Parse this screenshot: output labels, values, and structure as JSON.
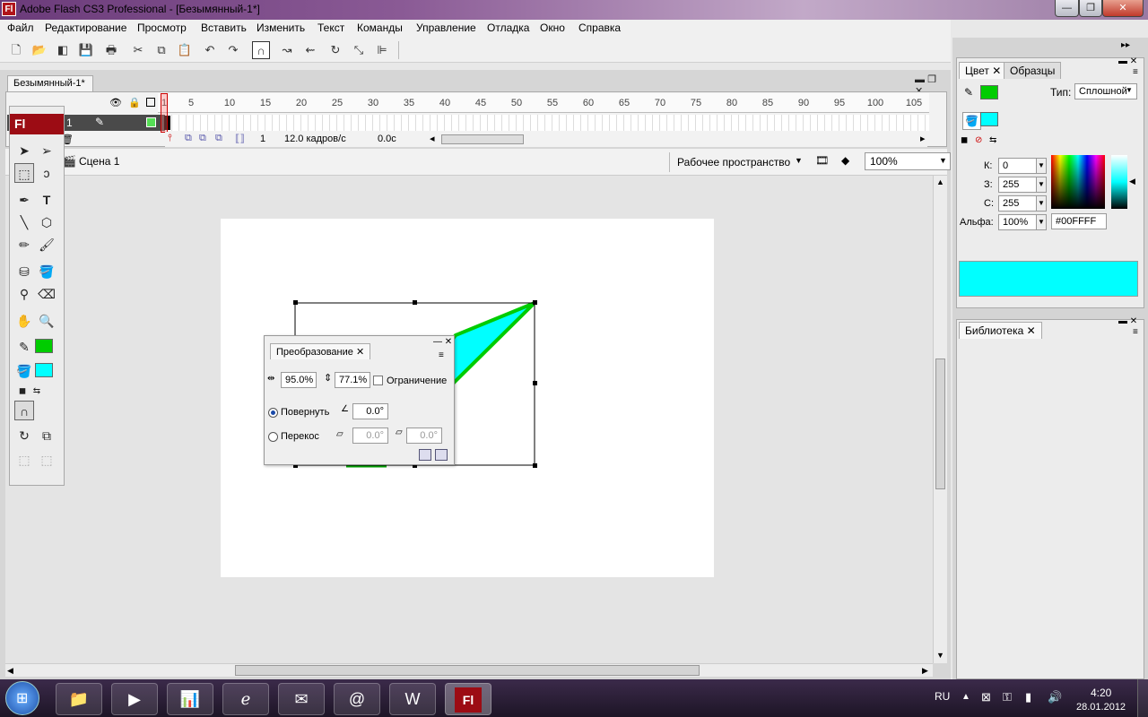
{
  "window": {
    "title": "Adobe Flash CS3 Professional - [Безымянный-1*]",
    "app_icon": "Fl"
  },
  "menu": [
    "Файл",
    "Редактирование",
    "Просмотр",
    "Вставить",
    "Изменить",
    "Текст",
    "Команды",
    "Управление",
    "Отладка",
    "Окно",
    "Справка"
  ],
  "document": {
    "tab": "Безымянный-1*"
  },
  "timeline": {
    "ruler": [
      "1",
      "5",
      "10",
      "15",
      "20",
      "25",
      "30",
      "35",
      "40",
      "45",
      "50",
      "55",
      "60",
      "65",
      "70",
      "75",
      "80",
      "85",
      "90",
      "95",
      "100",
      "105"
    ],
    "layer_name": "1",
    "current_frame": "1",
    "frame_rate": "12.0 кадров/с",
    "elapsed": "0.0с"
  },
  "scene": {
    "name": "Сцена 1",
    "workspace": "Рабочее пространство",
    "zoom": "100%"
  },
  "tools": {
    "header": "Fl"
  },
  "color_panel": {
    "tabs": [
      "Цвет",
      "Образцы"
    ],
    "type_label": "Тип:",
    "type_value": "Сплошной",
    "r_label": "К:",
    "r_value": "0",
    "g_label": "З:",
    "g_value": "255",
    "b_label": "С:",
    "b_value": "255",
    "alpha_label": "Альфа:",
    "alpha_value": "100%",
    "hex": "#00FFFF",
    "stroke_color": "#00cc00",
    "fill_color": "#00ffff"
  },
  "library_panel": {
    "tab": "Библиотека"
  },
  "transform_panel": {
    "title": "Преобразование",
    "width_pct": "95.0%",
    "height_pct": "77.1%",
    "constrain": "Ограничение",
    "rotate_label": "Повернуть",
    "rotate_value": "0.0°",
    "skew_label": "Перекос",
    "skew_h": "0.0°",
    "skew_v": "0.0°"
  },
  "taskbar": {
    "lang": "RU",
    "time": "4:20",
    "date": "28.01.2012"
  }
}
